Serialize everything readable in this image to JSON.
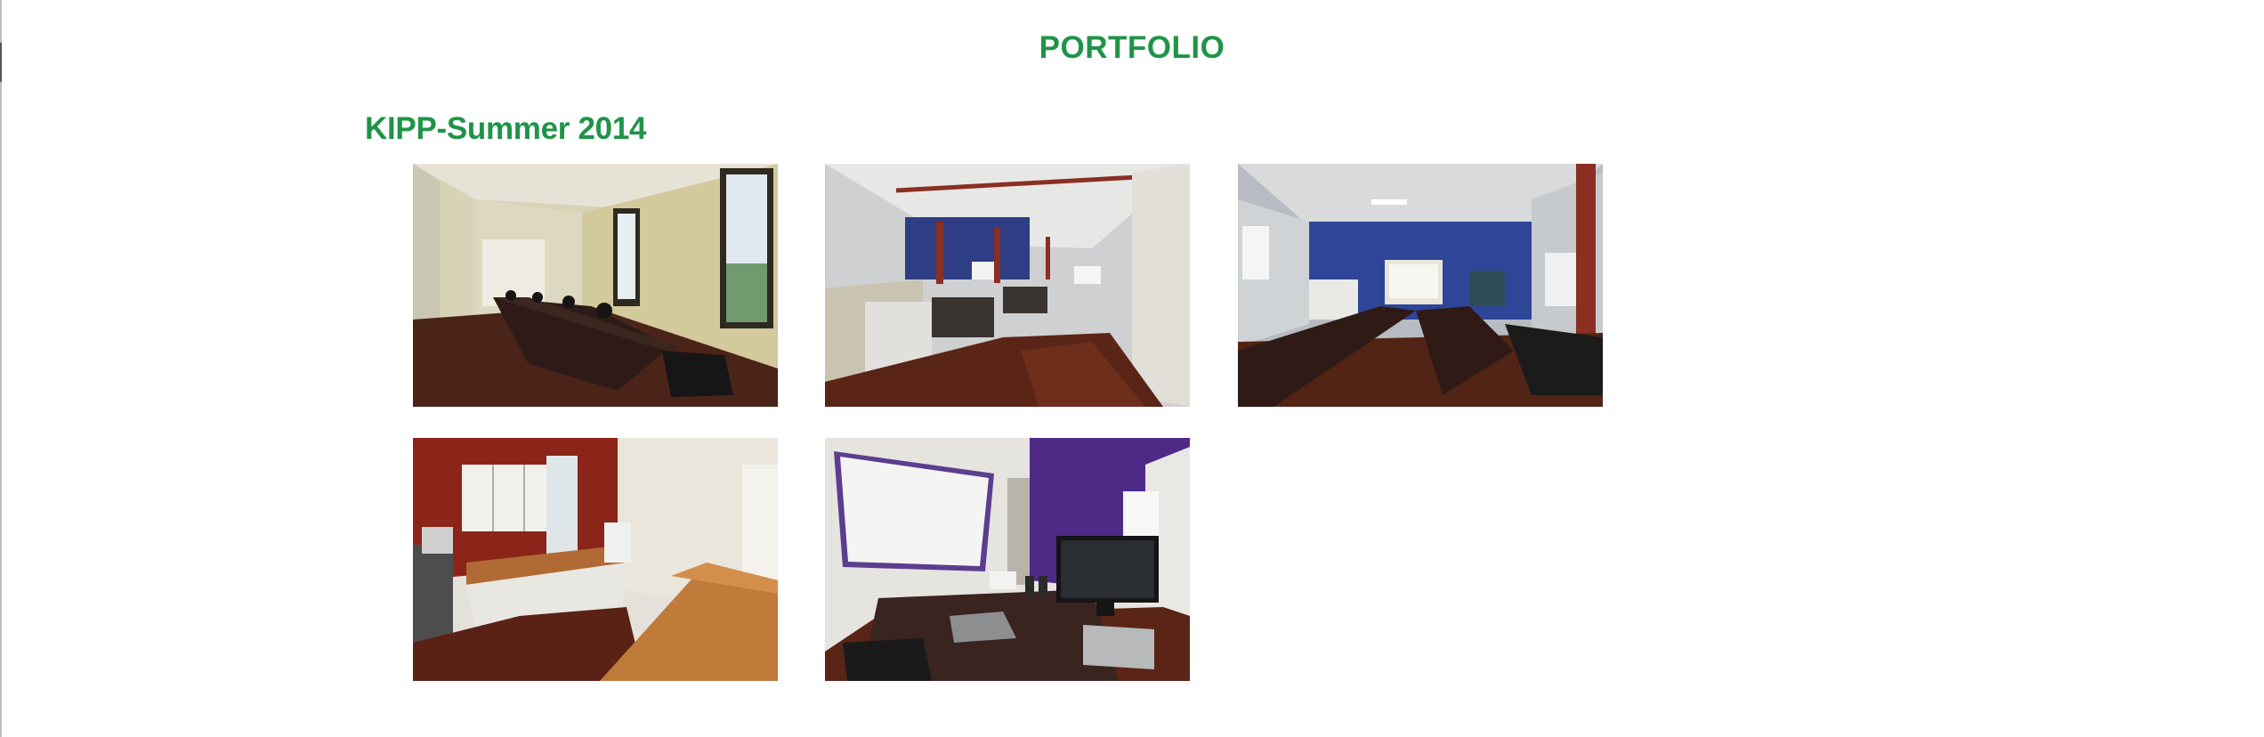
{
  "page": {
    "title": "PORTFOLIO"
  },
  "section": {
    "heading": "KIPP-Summer 2014"
  },
  "gallery": {
    "photos": [
      {
        "subject": "long conference room with dark table and windows"
      },
      {
        "subject": "open office with blue wall and cubicle desks"
      },
      {
        "subject": "training room with blue wall and conference tables"
      },
      {
        "subject": "kitchenette with white cabinets and butcher-block table"
      },
      {
        "subject": "private office with whiteboard, purple wall and desk with monitor"
      }
    ]
  },
  "colors": {
    "accent_green": "#1f9448",
    "background": "#ffffff"
  }
}
